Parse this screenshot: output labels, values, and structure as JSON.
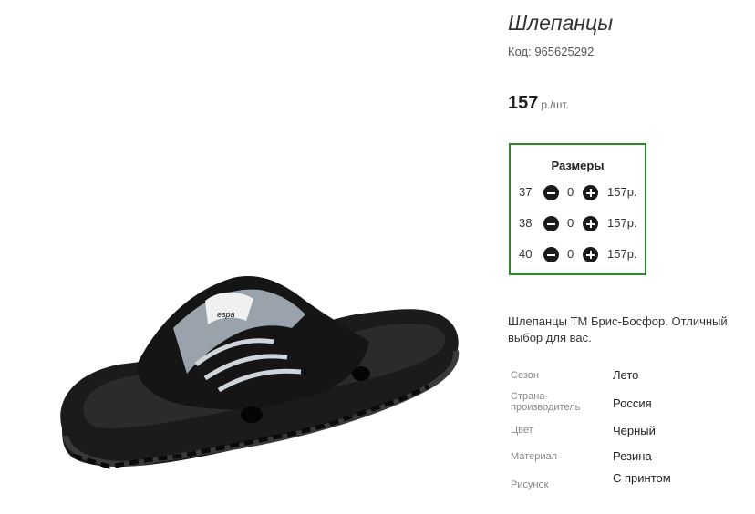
{
  "product": {
    "title": "Шлепанцы",
    "code_label": "Код: 965625292",
    "price_value": "157",
    "price_unit": "р./шт."
  },
  "sizes": {
    "title": "Размеры",
    "rows": [
      {
        "size": "37",
        "qty": "0",
        "price": "157р."
      },
      {
        "size": "38",
        "qty": "0",
        "price": "157р."
      },
      {
        "size": "40",
        "qty": "0",
        "price": "157р."
      }
    ]
  },
  "description": "Шлепанцы ТМ Брис-Босфор. Отличный выбор для вас.",
  "attributes": [
    {
      "label": "Сезон",
      "value": "Лето"
    },
    {
      "label": "Страна-производитель",
      "value": "Россия"
    },
    {
      "label": "Цвет",
      "value": "Чёрный"
    },
    {
      "label": "Материал",
      "value": "Резина"
    },
    {
      "label": "Рисунок",
      "value": "С принтом"
    }
  ],
  "image": {
    "logo_text": "espa"
  },
  "colors": {
    "accent_border": "#2a8a2a",
    "button": "#1a1a1a"
  }
}
